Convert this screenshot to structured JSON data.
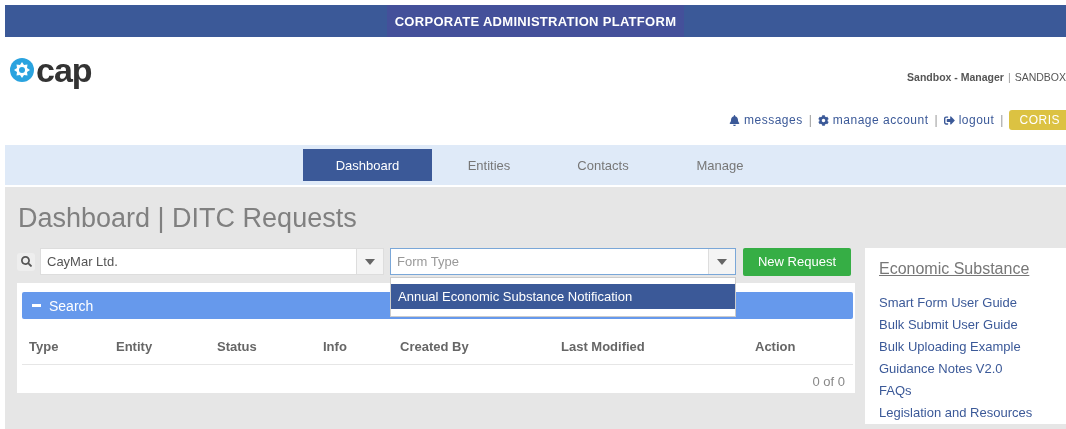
{
  "banner": {
    "title": "CORPORATE ADMINISTRATION PLATFORM"
  },
  "logo": {
    "text": "cap"
  },
  "user": {
    "name": "Sandbox - Manager",
    "separator": "|",
    "org": "SANDBOX"
  },
  "links": [
    {
      "kind": "bell",
      "label": "messages",
      "separator": "|"
    },
    {
      "kind": "gear",
      "label": "manage account",
      "separator": "|"
    },
    {
      "kind": "exit",
      "label": "logout",
      "separator": "|"
    }
  ],
  "env_badge": "CORIS",
  "tabs": [
    {
      "label": "Dashboard",
      "selected": true
    },
    {
      "label": "Entities",
      "selected": false
    },
    {
      "label": "Contacts",
      "selected": false
    },
    {
      "label": "Manage",
      "selected": false
    }
  ],
  "page_title": "Dashboard | DITC Requests",
  "entity_select": {
    "value": "CayMar Ltd."
  },
  "form_type_select": {
    "placeholder": "Form Type",
    "expanded": true,
    "options": [
      {
        "label": "Annual Economic Substance Notification",
        "selected": true
      }
    ]
  },
  "new_request_button": "New Request",
  "search_panel": {
    "label": "Search",
    "expanded": true
  },
  "table": {
    "columns": [
      "Type",
      "Entity",
      "Status",
      "Info",
      "Created By",
      "Last Modified",
      "Action"
    ],
    "count": "0 of 0"
  },
  "sidebar": {
    "title": "Economic Substance",
    "links": [
      "Smart Form User Guide",
      "Bulk Submit User Guide",
      "Bulk Uploading Example",
      "Guidance Notes V2.0",
      "FAQs",
      "Legislation and Resources"
    ]
  }
}
